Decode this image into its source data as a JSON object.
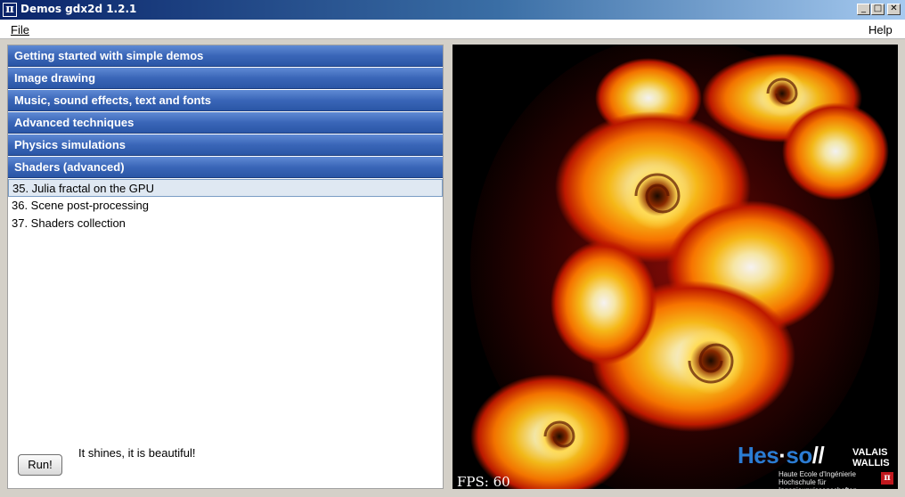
{
  "window": {
    "title": "Demos gdx2d 1.2.1"
  },
  "menubar": {
    "file": "File",
    "help": "Help"
  },
  "categories": [
    "Getting started with simple demos",
    "Image drawing",
    "Music, sound effects, text and fonts",
    "Advanced techniques",
    "Physics simulations",
    "Shaders (advanced)"
  ],
  "demos": [
    {
      "label": "35. Julia fractal on the GPU",
      "selected": true
    },
    {
      "label": "36. Scene post-processing",
      "selected": false
    },
    {
      "label": "37. Shaders collection",
      "selected": false
    }
  ],
  "run_button": "Run!",
  "description": "It shines, it is beautiful!",
  "viewer": {
    "fps": "FPS: 60",
    "logo": {
      "hes": "Hes",
      "dot": "·",
      "so": "so",
      "valais": "VALAIS",
      "wallis": "WALLIS",
      "line1": "Haute Ecole d'Ingénierie",
      "line2": "Hochschule für Ingenieurwissenschaften",
      "pi": "π"
    }
  },
  "colors": {
    "accent": "#3a66b8",
    "title_bar": "#0a246a",
    "logo_blue": "#2b7cd3"
  }
}
